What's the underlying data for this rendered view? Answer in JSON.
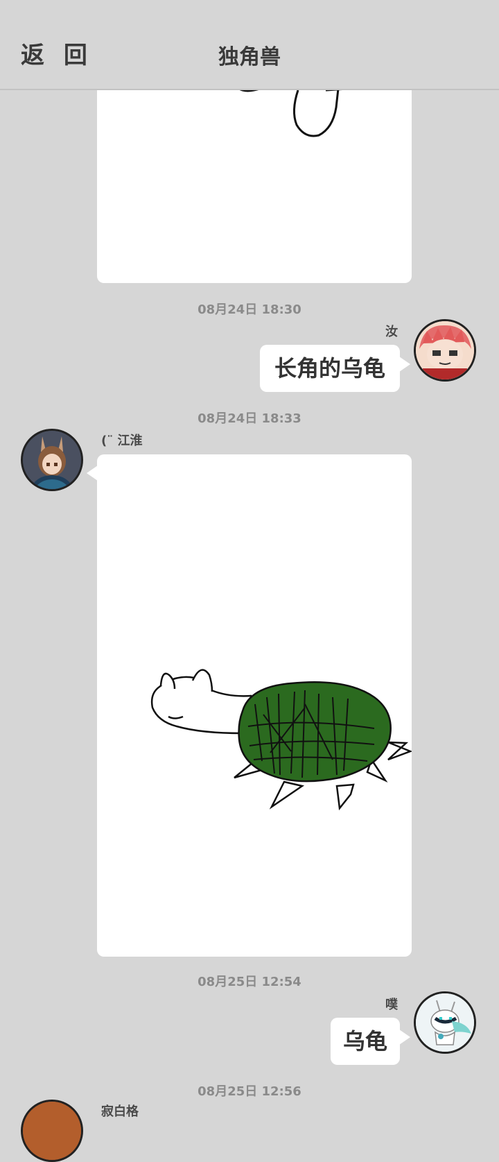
{
  "header": {
    "back_label": "返 回",
    "title": "独角兽"
  },
  "messages": [
    {
      "type": "image",
      "side": "left",
      "description": "sketch"
    },
    {
      "timestamp": "08月24日  18:30",
      "sender": "汝",
      "side": "right",
      "text": "长角的乌龟"
    },
    {
      "timestamp": "08月24日  18:33",
      "sender": "(¨ 江淮",
      "side": "left",
      "type": "image"
    },
    {
      "timestamp": "08月25日  12:54",
      "sender": "噗",
      "side": "right",
      "text": "乌龟"
    },
    {
      "timestamp": "08月25日  12:56",
      "sender": "寂白格",
      "side": "left"
    }
  ],
  "colors": {
    "background": "#d6d6d6",
    "bubble": "#ffffff",
    "shell": "#2b6a1f"
  }
}
